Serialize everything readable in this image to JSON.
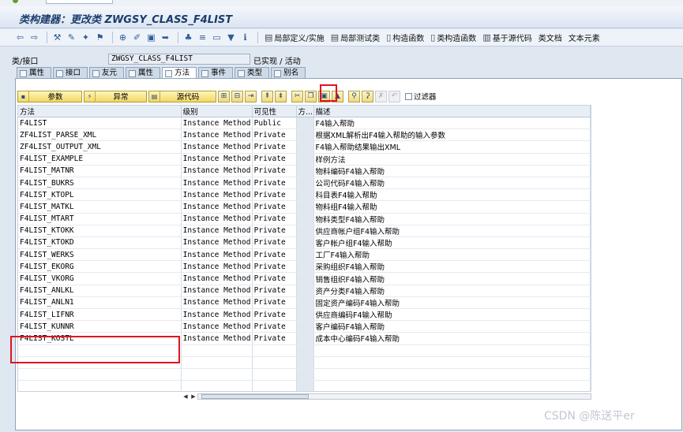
{
  "window": {
    "title": "类构建器：更改类 ZWGSY_CLASS_F4LIST"
  },
  "appbar": {
    "buttons": [
      "局部定义/实施",
      "局部测试类",
      "构造函数",
      "类构造函数",
      "基于源代码",
      "类文档",
      "文本元素"
    ]
  },
  "header": {
    "label": "类/接口",
    "class_name": "ZWGSY_CLASS_F4LIST",
    "status": "已实现 / 活动"
  },
  "tabs": [
    "属性",
    "接口",
    "友元",
    "属性",
    "方法",
    "事件",
    "类型",
    "别名"
  ],
  "toolbar": {
    "param_label": "参数",
    "exception_label": "异常",
    "source_label": "源代码",
    "filter_label": "过滤器"
  },
  "table": {
    "columns": [
      "方法",
      "级别",
      "可见性",
      "方...",
      "描述"
    ],
    "rows": [
      [
        "F4LIST",
        "Instance Method",
        "Public",
        "",
        "F4输入帮助"
      ],
      [
        "ZF4LIST_PARSE_XML",
        "Instance Method",
        "Private",
        "",
        "根据XML解析出F4输入帮助的输入参数"
      ],
      [
        "ZF4LIST_OUTPUT_XML",
        "Instance Method",
        "Private",
        "",
        "F4输入帮助结果输出XML"
      ],
      [
        "F4LIST_EXAMPLE",
        "Instance Method",
        "Private",
        "",
        "样例方法"
      ],
      [
        "F4LIST_MATNR",
        "Instance Method",
        "Private",
        "",
        "物料编码F4输入帮助"
      ],
      [
        "F4LIST_BUKRS",
        "Instance Method",
        "Private",
        "",
        "公司代码F4输入帮助"
      ],
      [
        "F4LIST_KTOPL",
        "Instance Method",
        "Private",
        "",
        "科目表F4输入帮助"
      ],
      [
        "F4LIST_MATKL",
        "Instance Method",
        "Private",
        "",
        "物料组F4输入帮助"
      ],
      [
        "F4LIST_MTART",
        "Instance Method",
        "Private",
        "",
        "物料类型F4输入帮助"
      ],
      [
        "F4LIST_KTOKK",
        "Instance Method",
        "Private",
        "",
        "供应商帐户组F4输入帮助"
      ],
      [
        "F4LIST_KTOKD",
        "Instance Method",
        "Private",
        "",
        "客户帐户组F4输入帮助"
      ],
      [
        "F4LIST_WERKS",
        "Instance Method",
        "Private",
        "",
        "工厂F4输入帮助"
      ],
      [
        "F4LIST_EKORG",
        "Instance Method",
        "Private",
        "",
        "采购组织F4输入帮助"
      ],
      [
        "F4LIST_VKORG",
        "Instance Method",
        "Private",
        "",
        "销售组织F4输入帮助"
      ],
      [
        "F4LIST_ANLKL",
        "Instance Method",
        "Private",
        "",
        "资产分类F4输入帮助"
      ],
      [
        "F4LIST_ANLN1",
        "Instance Method",
        "Private",
        "",
        "固定资产编码F4输入帮助"
      ],
      [
        "F4LIST_LIFNR",
        "Instance Method",
        "Private",
        "",
        "供应商编码F4输入帮助"
      ],
      [
        "F4LIST_KUNNR",
        "Instance Method",
        "Private",
        "",
        "客户编码F4输入帮助"
      ],
      [
        "F4LIST_KOSTL",
        "Instance Method",
        "Private",
        "",
        "成本中心编码F4输入帮助"
      ],
      [
        "",
        "",
        "",
        "",
        ""
      ],
      [
        "",
        "",
        "",
        "",
        ""
      ],
      [
        "",
        "",
        "",
        "",
        ""
      ],
      [
        "",
        "",
        "",
        "",
        ""
      ]
    ]
  },
  "watermark": "CSDN @陈送平er",
  "colors": {
    "highlight_box": "#e0141e",
    "title_text": "#1c3d6e",
    "toolbar_yellow": "#f1d765"
  }
}
